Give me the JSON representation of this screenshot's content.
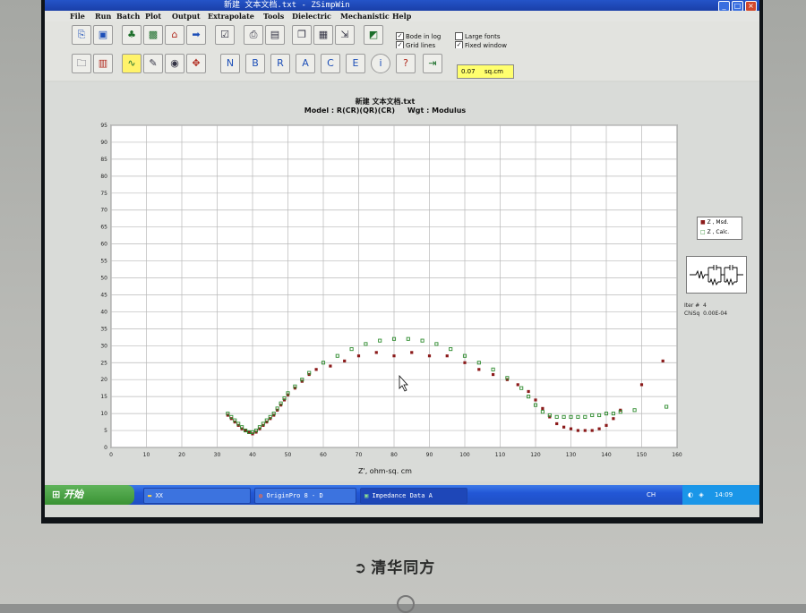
{
  "window": {
    "title": "新建 文本文档.txt - ZSimpWin",
    "controls": {
      "minimize": "_",
      "maximize": "□",
      "close": "×"
    }
  },
  "menu": [
    "File",
    "Run",
    "Batch",
    "Plot",
    "Output",
    "Extrapolate",
    "Tools",
    "Dielectric",
    "Mechanistic",
    "Help"
  ],
  "toolbar": {
    "checkboxes": [
      {
        "label": "Bode in log",
        "checked": true
      },
      {
        "label": "Grid lines",
        "checked": true
      },
      {
        "label": "Large fonts",
        "checked": false
      },
      {
        "label": "Fixed window",
        "checked": true
      }
    ],
    "area_value": "0.07",
    "area_unit": "sq.cm",
    "row1_icons": [
      "open-icon",
      "save-icon",
      "run-icon",
      "batch-icon",
      "home-icon",
      "arrow-right-icon",
      "checklist-icon",
      "print-icon",
      "report-icon",
      "copy-icon",
      "paste-icon",
      "export-icon",
      "chart-icon"
    ],
    "row2_icons": [
      "folder-icon",
      "disk-icon",
      "waveform-icon",
      "edit-icon",
      "eye-icon",
      "move-icon",
      "nyquist-icon",
      "bode-icon",
      "real-imag-icon",
      "admittance-icon",
      "capacitance-icon",
      "modulus-icon",
      "info-icon",
      "help-icon",
      "exit-icon"
    ],
    "row2_icon_glyphs": [
      "N",
      "B",
      "R",
      "A",
      "C",
      "E"
    ]
  },
  "chart_data": {
    "type": "scatter",
    "title": "新建 文本文档.txt",
    "subtitle": "Model : R(CR)(QR)(CR)     Wgt : Modulus",
    "xlabel": "Z', ohm-sq. cm",
    "ylabel": "",
    "xlim": [
      0,
      160
    ],
    "ylim": [
      0,
      95
    ],
    "xticks": [
      0,
      10,
      20,
      30,
      40,
      50,
      60,
      70,
      80,
      90,
      100,
      110,
      120,
      130,
      140,
      150,
      160
    ],
    "yticks": [
      0,
      5,
      10,
      15,
      20,
      25,
      30,
      35,
      40,
      45,
      50,
      55,
      60,
      65,
      70,
      75,
      80,
      85,
      90,
      95
    ],
    "grid": true,
    "legend_position": "right",
    "series": [
      {
        "name": "Z , Msd.",
        "color": "#8b1a1a",
        "x": [
          33,
          34,
          35,
          36,
          37,
          38,
          39,
          40,
          41,
          42,
          43,
          44,
          45,
          46,
          47,
          48,
          49,
          50,
          52,
          54,
          56,
          58,
          62,
          66,
          70,
          75,
          80,
          85,
          90,
          95,
          100,
          104,
          108,
          112,
          115,
          118,
          120,
          122,
          124,
          126,
          128,
          130,
          132,
          134,
          136,
          138,
          140,
          142,
          144,
          150,
          156
        ],
        "y": [
          9.5,
          8.5,
          7.5,
          6.5,
          5.5,
          5,
          4.5,
          4,
          4.5,
          5.5,
          6.5,
          7.5,
          8.5,
          9.5,
          11,
          12.5,
          14,
          15.5,
          17.5,
          19.5,
          21.5,
          23,
          24,
          25.5,
          27,
          28,
          27,
          28,
          27,
          27,
          25,
          23,
          21.5,
          20,
          18.5,
          16.5,
          14,
          11.5,
          9,
          7,
          6,
          5.5,
          5,
          5,
          5,
          5.5,
          6.5,
          8.5,
          11,
          18.5,
          25.5
        ]
      },
      {
        "name": "Z , Calc.",
        "color": "#2e8b2e",
        "x": [
          33,
          34,
          35,
          36,
          37,
          38,
          39,
          40,
          41,
          42,
          43,
          44,
          45,
          46,
          47,
          48,
          49,
          50,
          52,
          54,
          56,
          60,
          64,
          68,
          72,
          76,
          80,
          84,
          88,
          92,
          96,
          100,
          104,
          108,
          112,
          116,
          118,
          120,
          122,
          124,
          126,
          128,
          130,
          132,
          134,
          136,
          138,
          140,
          142,
          144,
          148,
          157
        ],
        "y": [
          10,
          9,
          8,
          7,
          6,
          5,
          4.5,
          4.5,
          5,
          6,
          7,
          8,
          9,
          10,
          11.5,
          13,
          14.5,
          16,
          18,
          20,
          22,
          25,
          27,
          29,
          30.5,
          31.5,
          32,
          32,
          31.5,
          30.5,
          29,
          27,
          25,
          23,
          20.5,
          17.5,
          15,
          12.5,
          10.5,
          9.5,
          9,
          9,
          9,
          9,
          9,
          9.5,
          9.5,
          10,
          10,
          10.5,
          11,
          12
        ]
      }
    ]
  },
  "legend": {
    "items": [
      {
        "label": "Z , Msd.",
        "color": "#8b1a1a"
      },
      {
        "label": "Z , Calc.",
        "color": "#2e8b2e"
      }
    ]
  },
  "fit_info": {
    "line1_label": "Iter #",
    "line1_value": "4",
    "line2_label": "ChiSq",
    "line2_value": "0.00E-04"
  },
  "taskbar": {
    "start_label": "开始",
    "tasks": [
      {
        "label": "XX",
        "icon": "folder-icon"
      },
      {
        "label": "OriginPro 8 - D",
        "icon": "origin-icon"
      },
      {
        "label": "Impedance Data A",
        "icon": "zsimpwin-icon"
      }
    ],
    "language": "CH",
    "clock": "14:09"
  },
  "monitor": {
    "brand": "清华同方"
  }
}
